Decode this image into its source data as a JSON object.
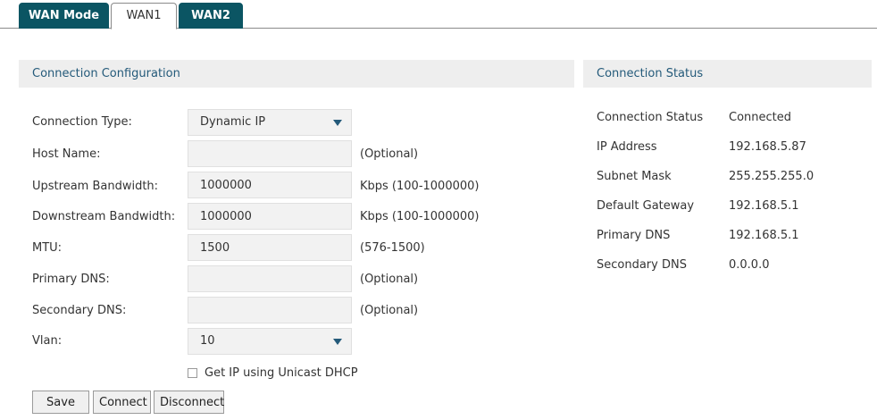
{
  "tabs": [
    {
      "label": "WAN Mode",
      "active": false
    },
    {
      "label": "WAN1",
      "active": true
    },
    {
      "label": "WAN2",
      "active": false
    }
  ],
  "config": {
    "title": "Connection Configuration",
    "connection_type_label": "Connection Type:",
    "connection_type_value": "Dynamic IP",
    "host_name_label": "Host Name:",
    "host_name_value": "",
    "host_name_hint": "(Optional)",
    "upstream_label": "Upstream Bandwidth:",
    "upstream_value": "1000000",
    "upstream_hint": "Kbps (100-1000000)",
    "downstream_label": "Downstream Bandwidth:",
    "downstream_value": "1000000",
    "downstream_hint": "Kbps (100-1000000)",
    "mtu_label": "MTU:",
    "mtu_value": "1500",
    "mtu_hint": "(576-1500)",
    "primary_dns_label": "Primary DNS:",
    "primary_dns_value": "",
    "primary_dns_hint": "(Optional)",
    "secondary_dns_label": "Secondary DNS:",
    "secondary_dns_value": "",
    "secondary_dns_hint": "(Optional)",
    "vlan_label": "Vlan:",
    "vlan_value": "10",
    "unicast_label": "Get IP using Unicast DHCP",
    "unicast_checked": false
  },
  "buttons": {
    "save": "Save",
    "connect": "Connect",
    "disconnect": "Disconnect"
  },
  "status": {
    "title": "Connection Status",
    "rows": [
      {
        "label": "Connection Status",
        "value": "Connected"
      },
      {
        "label": "IP Address",
        "value": "192.168.5.87"
      },
      {
        "label": "Subnet Mask",
        "value": "255.255.255.0"
      },
      {
        "label": "Default Gateway",
        "value": "192.168.5.1"
      },
      {
        "label": "Primary DNS",
        "value": "192.168.5.1"
      },
      {
        "label": "Secondary DNS",
        "value": "0.0.0.0"
      }
    ]
  },
  "colors": {
    "tab_inactive": "#0b5563",
    "header_text": "#245a7a",
    "panel_header_bg": "#eeeeee"
  }
}
